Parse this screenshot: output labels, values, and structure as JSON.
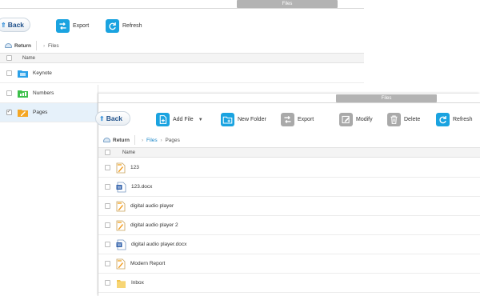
{
  "back_window": {
    "title": "Files",
    "back_label": "Back",
    "toolbar": {
      "export_label": "Export",
      "refresh_label": "Refresh"
    },
    "nav": {
      "return_label": "Return",
      "breadcrumb": "Files"
    },
    "table": {
      "header_name": "Name",
      "rows": [
        {
          "name": "Keynote",
          "icon": "keynote-folder-icon",
          "selected": false
        },
        {
          "name": "Numbers",
          "icon": "numbers-folder-icon",
          "selected": false
        },
        {
          "name": "Pages",
          "icon": "pages-folder-icon",
          "selected": true
        }
      ]
    }
  },
  "front_window": {
    "title": "Files",
    "back_label": "Back",
    "toolbar": {
      "add_file_label": "Add File",
      "new_folder_label": "New Folder",
      "export_label": "Export",
      "modify_label": "Modify",
      "delete_label": "Delete",
      "refresh_label": "Refresh"
    },
    "nav": {
      "return_label": "Return",
      "breadcrumb_root": "Files",
      "breadcrumb_current": "Pages"
    },
    "table": {
      "header_name": "Name",
      "rows": [
        {
          "name": "123",
          "icon": "pages-doc-icon"
        },
        {
          "name": "123.docx",
          "icon": "word-doc-icon"
        },
        {
          "name": "digital audio player",
          "icon": "pages-doc-icon"
        },
        {
          "name": "digital audio player 2",
          "icon": "pages-doc-icon"
        },
        {
          "name": "digital audio player.docx",
          "icon": "word-doc-icon"
        },
        {
          "name": "Modern Report",
          "icon": "pages-doc-icon"
        },
        {
          "name": "Inbox",
          "icon": "folder-icon"
        }
      ]
    }
  },
  "colors": {
    "accent_blue": "#1aa3e0",
    "disabled_gray": "#a9a9a9",
    "selected_row": "#e6f1fa",
    "link": "#1a86c8"
  }
}
